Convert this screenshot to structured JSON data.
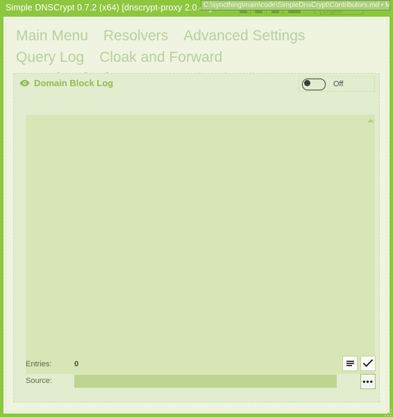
{
  "window": {
    "title": "Simple DNSCrypt 0.7.2 (x64) [dnscrypt-proxy 2.0.42]",
    "overlay_path": "C:\\syncthing\\main\\code\\SimpleDnsCrypt\\Contributors.md • Modified",
    "overlay_language": "English",
    "overlay_chevron": "⌃"
  },
  "tabs": [
    {
      "label": "Main Menu",
      "active": false
    },
    {
      "label": "Resolvers",
      "active": false
    },
    {
      "label": "Advanced Settings",
      "active": false
    },
    {
      "label": "Query Log",
      "active": false
    },
    {
      "label": "Cloak and Forward",
      "active": false
    },
    {
      "label": "Domain Block Log",
      "active": true
    },
    {
      "label": "Domain Blacklist",
      "active": false
    }
  ],
  "panel": {
    "title": "Domain Block Log",
    "icon": "eye-icon",
    "toggle": {
      "state_label": "Off",
      "checked": false
    },
    "log_text": ""
  },
  "footer": {
    "entries_label": "Entries:",
    "entries_value": "0",
    "source_label": "Source:",
    "source_value": "",
    "source_placeholder": "",
    "clear_button_icon": "clear-list-icon",
    "apply_button_icon": "check-icon",
    "browse_button_label": "•••"
  },
  "colors": {
    "window_chrome": "#8dc63f",
    "content_bg": "#eef4e0",
    "panel_bg": "#e2ecce",
    "log_bg": "#d8e5b7",
    "accent": "#77a93d",
    "tab_inactive": "#b9cea0",
    "input_bg": "#bed490"
  }
}
